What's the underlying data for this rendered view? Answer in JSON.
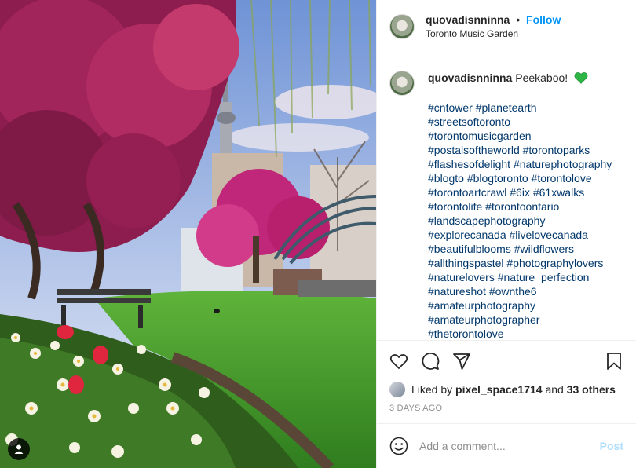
{
  "header": {
    "username": "quovadisnninna",
    "separator": "•",
    "follow_label": "Follow",
    "location": "Toronto Music Garden"
  },
  "caption": {
    "username": "quovadisnninna",
    "text": "Peekaboo!",
    "emoji_icon": "green-heart-icon",
    "hashtag_lines": [
      "#cntower #planetearth",
      "#streetsoftoronto",
      "#torontomusicgarden",
      "#postalsoftheworld #torontoparks",
      "#flashesofdelight #naturephotography",
      "#blogto #blogtoronto #torontolove",
      "#torontoartcrawl #6ix #61xwalks",
      "#torontolife #torontoontario",
      "#landscapephotography",
      "#explorecanada #livelovecanada",
      "#beautifulblooms #wildflowers",
      "#allthingspastel #photographylovers",
      "#naturelovers #nature_perfection",
      "#natureshot #ownthe6",
      "#amateurphotography",
      "#amateurphotographer",
      "#thetorontolove"
    ]
  },
  "actions": {
    "icons": [
      "heart-icon",
      "comment-icon",
      "share-icon",
      "bookmark-icon"
    ]
  },
  "likes": {
    "prefix": "Liked by",
    "user": "pixel_space1714",
    "middle": "and",
    "others": "33 others"
  },
  "timestamp": "3 DAYS AGO",
  "comment": {
    "placeholder": "Add a comment...",
    "post_label": "Post"
  },
  "colors": {
    "accent": "#0095f6",
    "post_disabled": "#b2dffc",
    "hashtag": "#00376b",
    "heart": "#2fb545"
  }
}
